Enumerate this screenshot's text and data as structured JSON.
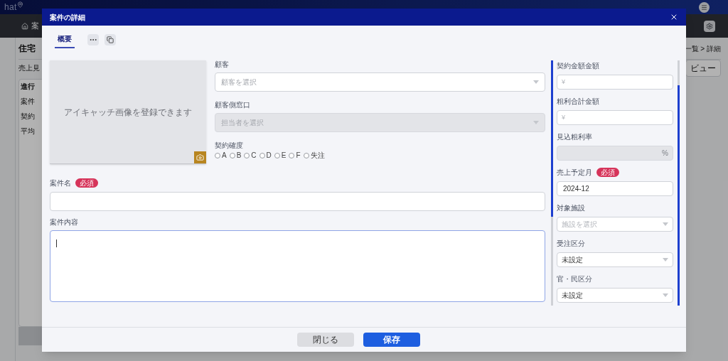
{
  "background": {
    "logo": "hat",
    "nav_item": "案",
    "page_title": "住宅",
    "breadcrumb": "一覧 > 詳細",
    "side_text": "売上見",
    "view_button": "ビュー",
    "card": {
      "title": "進行",
      "rows": [
        "案件",
        "契約",
        "平均"
      ]
    }
  },
  "dialog": {
    "title": "案件の詳細",
    "tabs": [
      {
        "label": "概要",
        "selected": true
      }
    ],
    "image_placeholder": "アイキャッチ画像を登録できます",
    "customer": {
      "label": "顧客",
      "placeholder": "顧客を選択",
      "disabled": false
    },
    "contact": {
      "label": "顧客側窓口",
      "placeholder": "担当者を選択",
      "disabled": true
    },
    "probability": {
      "label": "契約確度",
      "options": [
        {
          "label": "A",
          "selected": false
        },
        {
          "label": "B",
          "selected": false
        },
        {
          "label": "C",
          "selected": false
        },
        {
          "label": "D",
          "selected": false
        },
        {
          "label": "E",
          "selected": false
        },
        {
          "label": "F",
          "selected": false
        },
        {
          "label": "失注",
          "selected": false
        }
      ]
    },
    "name": {
      "label": "案件名",
      "badge": "必須"
    },
    "description": {
      "label": "案件内容",
      "focused": true
    },
    "side_fields": [
      {
        "kind": "input",
        "label": "契約金額金額",
        "prefix": "¥",
        "disabled": false
      },
      {
        "kind": "input",
        "label": "粗利合計金額",
        "prefix": "¥",
        "disabled": false
      },
      {
        "kind": "input",
        "label": "見込粗利率",
        "suffix": "%",
        "disabled": true
      },
      {
        "kind": "input",
        "label": "売上予定月",
        "badge": "必須",
        "value": "2024-12",
        "disabled": false
      },
      {
        "kind": "select",
        "label": "対象施設",
        "placeholder": "施設を選択"
      },
      {
        "kind": "select",
        "label": "受注区分",
        "value": "未設定"
      },
      {
        "kind": "select",
        "label": "官・民区分",
        "value": "未設定"
      }
    ],
    "buttons": [
      {
        "label": "閉じる",
        "kind": "secondary"
      },
      {
        "label": "保存",
        "kind": "primary"
      }
    ]
  }
}
